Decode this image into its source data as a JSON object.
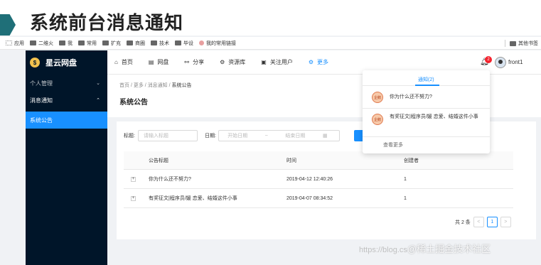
{
  "slide": {
    "title": "系统前台消息通知"
  },
  "bookmarks": {
    "items": [
      "应用",
      "二维火",
      "我",
      "常用",
      "扩充",
      "商圈",
      "技术",
      "毕设",
      "我的常用链接"
    ],
    "other": "其他书签"
  },
  "app": {
    "logo": "星云网盘",
    "logo_glyph": "$",
    "sidebar": {
      "groups": [
        {
          "label": "个人管理",
          "chevron": "⌄"
        },
        {
          "label": "消息通知",
          "chevron": "⌃"
        }
      ],
      "active_item": "系统公告"
    },
    "nav": [
      {
        "label": "首页",
        "icon": "home-icon",
        "glyph": "⌂"
      },
      {
        "label": "网盘",
        "icon": "disk-icon",
        "glyph": "▤"
      },
      {
        "label": "分享",
        "icon": "share-icon",
        "glyph": "⚯"
      },
      {
        "label": "资源库",
        "icon": "library-icon",
        "glyph": "⚙"
      },
      {
        "label": "关注用户",
        "icon": "users-icon",
        "glyph": "▣"
      },
      {
        "label": "更多",
        "icon": "more-icon",
        "glyph": "⚙",
        "active": true
      }
    ],
    "bell_badge": "2",
    "username": "front1",
    "breadcrumb": [
      "首页",
      "更多",
      "消息通知",
      "系统公告"
    ],
    "page_title": "系统公告",
    "filter": {
      "title_label": "标题:",
      "title_placeholder": "请输入标题",
      "date_label": "日期:",
      "start_placeholder": "开始日期",
      "separator": "~",
      "end_placeholder": "结束日期"
    },
    "table": {
      "columns": [
        "公告标题",
        "时间",
        "创建者"
      ],
      "rows": [
        {
          "title": "你为什么还不努力?",
          "time": "2019-04-12 12:40:26",
          "creator": "1"
        },
        {
          "title": "有奖征文|程序员/媛 恋爱、结婚这件小事",
          "time": "2019-04-07 08:34:52",
          "creator": "1"
        }
      ]
    },
    "pagination": {
      "total": "共 2 条",
      "current": "1",
      "prev": "<",
      "next": ">"
    },
    "notifications": {
      "tab": "通知(2)",
      "avatar_text": "企鹅",
      "items": [
        "你为什么还不努力?",
        "有奖征文|程序员/媛 恋爱、结婚这件小事"
      ],
      "more": "查看更多"
    }
  },
  "watermark": {
    "url": "https://blog.cs",
    "text": "@稀土掘金技术社区"
  },
  "colors": {
    "primary": "#1890ff",
    "sidebar": "#001529",
    "badge": "#f5222d",
    "slide_accent": "#1f6f78"
  }
}
